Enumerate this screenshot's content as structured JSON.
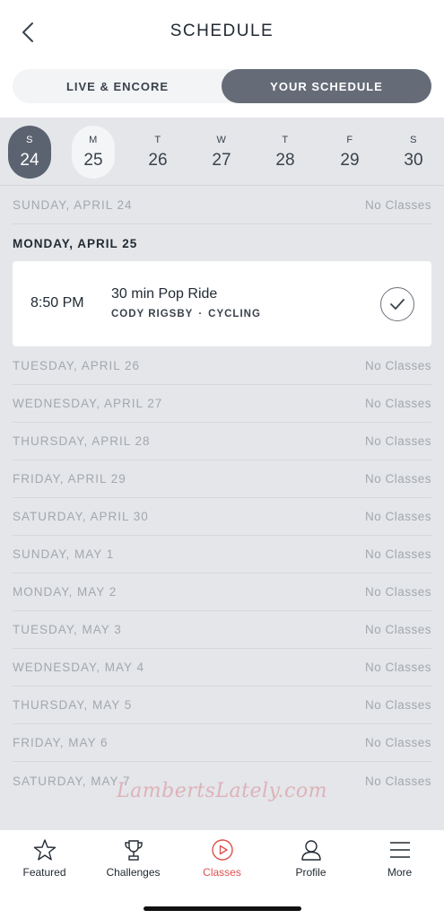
{
  "header": {
    "title": "SCHEDULE"
  },
  "segment": {
    "left": "LIVE & ENCORE",
    "right": "YOUR SCHEDULE"
  },
  "days": [
    {
      "letter": "S",
      "num": "24"
    },
    {
      "letter": "M",
      "num": "25"
    },
    {
      "letter": "T",
      "num": "26"
    },
    {
      "letter": "W",
      "num": "27"
    },
    {
      "letter": "T",
      "num": "28"
    },
    {
      "letter": "F",
      "num": "29"
    },
    {
      "letter": "S",
      "num": "30"
    }
  ],
  "schedule": [
    {
      "day": "SUNDAY, APRIL 24",
      "status": "No Classes"
    },
    {
      "day": "MONDAY, APRIL 25",
      "status": ""
    },
    {
      "day": "TUESDAY, APRIL 26",
      "status": "No Classes"
    },
    {
      "day": "WEDNESDAY, APRIL 27",
      "status": "No Classes"
    },
    {
      "day": "THURSDAY, APRIL 28",
      "status": "No Classes"
    },
    {
      "day": "FRIDAY, APRIL 29",
      "status": "No Classes"
    },
    {
      "day": "SATURDAY, APRIL 30",
      "status": "No Classes"
    },
    {
      "day": "SUNDAY, MAY 1",
      "status": "No Classes"
    },
    {
      "day": "MONDAY, MAY 2",
      "status": "No Classes"
    },
    {
      "day": "TUESDAY, MAY 3",
      "status": "No Classes"
    },
    {
      "day": "WEDNESDAY, MAY 4",
      "status": "No Classes"
    },
    {
      "day": "THURSDAY, MAY 5",
      "status": "No Classes"
    },
    {
      "day": "FRIDAY, MAY 6",
      "status": "No Classes"
    },
    {
      "day": "SATURDAY, MAY 7",
      "status": "No Classes"
    }
  ],
  "booked_class": {
    "time": "8:50 PM",
    "name": "30 min Pop Ride",
    "instructor": "CODY RIGSBY",
    "separator": "·",
    "discipline": "CYCLING"
  },
  "watermark": "LambertsLately.com",
  "tabs": [
    {
      "label": "Featured",
      "icon": "star-icon"
    },
    {
      "label": "Challenges",
      "icon": "trophy-icon"
    },
    {
      "label": "Classes",
      "icon": "play-circle-icon"
    },
    {
      "label": "Profile",
      "icon": "person-icon"
    },
    {
      "label": "More",
      "icon": "menu-icon"
    }
  ],
  "colors": {
    "accent": "#e0504e",
    "selected_day": "#5b6370",
    "segment_active": "#656c78",
    "content_bg": "#e4e6e9"
  }
}
